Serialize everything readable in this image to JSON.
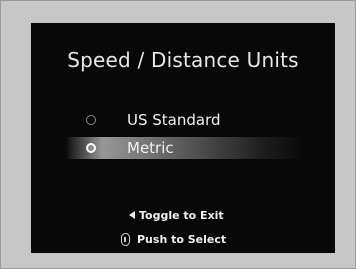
{
  "screen": {
    "title": "Speed / Distance Units",
    "options": [
      {
        "label": "US Standard",
        "selected": false
      },
      {
        "label": "Metric",
        "selected": true
      }
    ],
    "hints": [
      {
        "icon": "triangle-left-icon",
        "label": "Toggle to Exit"
      },
      {
        "icon": "knob-icon",
        "label": "Push to Select"
      }
    ]
  }
}
